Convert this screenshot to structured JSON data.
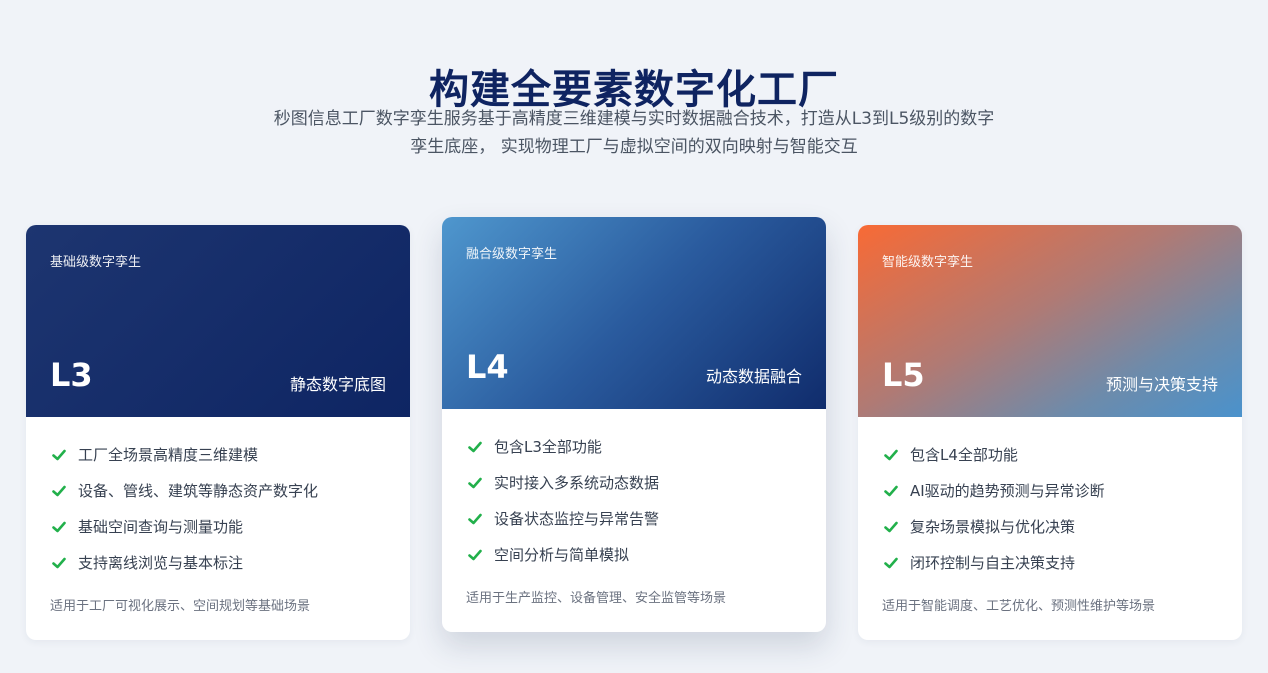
{
  "header": {
    "title": "构建全要素数字化工厂",
    "subtitle_line1": "秒图信息工厂数字孪生服务基于高精度三维建模与实时数据融合技术，打造从L3到L5级别的数字",
    "subtitle_line2": "孪生底座， 实现物理工厂与虚拟空间的双向映射与智能交互"
  },
  "cards": [
    {
      "tier": "基础级数字孪生",
      "level": "L3",
      "title": "静态数字底图",
      "features": [
        "工厂全场景高精度三维建模",
        "设备、管线、建筑等静态资产数字化",
        "基础空间查询与测量功能",
        "支持离线浏览与基本标注"
      ],
      "scene": "适用于工厂可视化展示、空间规划等基础场景"
    },
    {
      "tier": "融合级数字孪生",
      "level": "L4",
      "title": "动态数据融合",
      "features": [
        "包含L3全部功能",
        "实时接入多系统动态数据",
        "设备状态监控与异常告警",
        "空间分析与简单模拟"
      ],
      "scene": "适用于生产监控、设备管理、安全监管等场景"
    },
    {
      "tier": "智能级数字孪生",
      "level": "L5",
      "title": "预测与决策支持",
      "features": [
        "包含L4全部功能",
        "AI驱动的趋势预测与异常诊断",
        "复杂场景模拟与优化决策",
        "闭环控制与自主决策支持"
      ],
      "scene": "适用于智能调度、工艺优化、预测性维护等场景"
    }
  ],
  "colors": {
    "check": "#22b04b",
    "title": "#0f2461"
  },
  "icons": {
    "feature_marker": "check-icon"
  }
}
